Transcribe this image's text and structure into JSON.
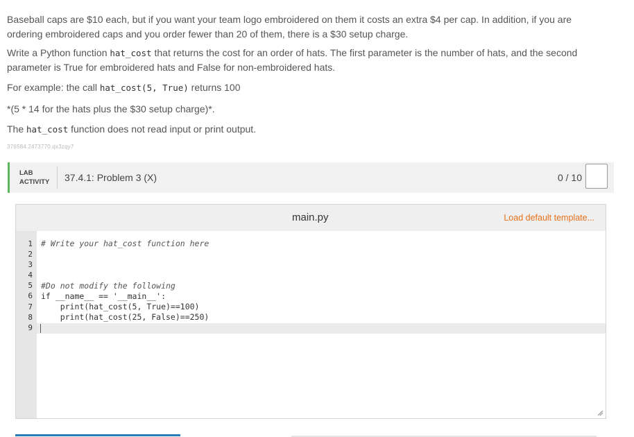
{
  "prose": {
    "p1": "Baseball caps are $10 each, but if you want your team logo embroidered on them it costs an extra $4 per cap. In addition, if you are ordering embroidered caps and you order fewer than 20 of them, there is a $30 setup charge.",
    "p2_pre": "Write a Python function ",
    "p2_code": "hat_cost",
    "p2_post": " that returns the cost for an order of hats. The first parameter is the number of hats, and the second parameter is True for embroidered hats and False for non-embroidered hats.",
    "p3_pre": "For example: the call ",
    "p3_code": "hat_cost(5, True)",
    "p3_post": " returns 100",
    "p4": "*(5 * 14 for the hats plus the $30 setup charge)*.",
    "p5_pre": "The ",
    "p5_code": "hat_cost",
    "p5_post": " function does not read input or print output.",
    "id_tag": "376584.2473770.qx3zqy7"
  },
  "lab": {
    "label_line1": "LAB",
    "label_line2": "ACTIVITY",
    "title": "37.4.1: Problem 3 (X)",
    "score": "0 / 10",
    "accent": "#5cb85c"
  },
  "editor": {
    "file_name": "main.py",
    "load_template": "Load default template...",
    "line_numbers": [
      "1",
      "2",
      "3",
      "4",
      "5",
      "6",
      "7",
      "8",
      "9"
    ],
    "lines": [
      "# Write your hat_cost function here",
      "",
      "",
      "",
      "#Do not modify the following",
      "if __name__ == '__main__':",
      "    print(hat_cost(5, True)==100)",
      "    print(hat_cost(25, False)==250)",
      ""
    ],
    "active_line": 9
  },
  "colors": {
    "link_orange": "#e8711a",
    "bottom_blue": "#2b7bb9"
  },
  "icons": {
    "resize": "resize-handle-icon"
  }
}
